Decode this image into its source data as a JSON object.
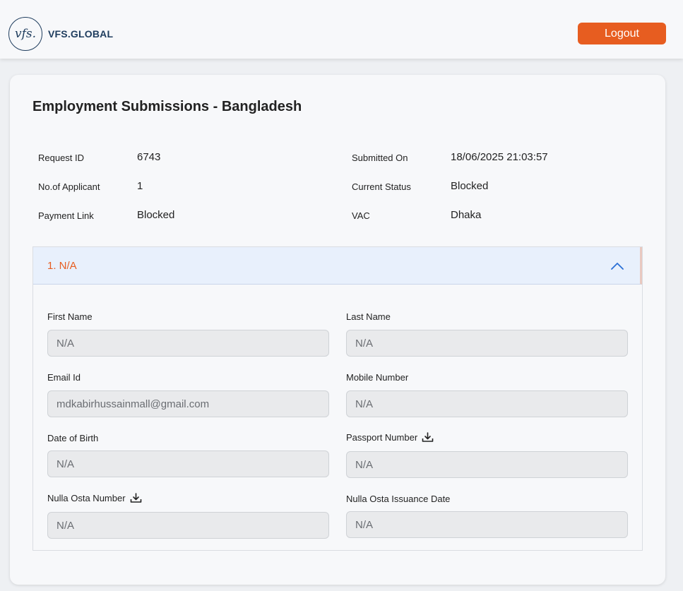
{
  "header": {
    "logo_mark": "vfs.",
    "logo_text": "VFS.GLOBAL",
    "logout_label": "Logout",
    "accent_color": "#e75d20"
  },
  "page": {
    "title": "Employment Submissions - Bangladesh"
  },
  "info": {
    "request_id_label": "Request ID",
    "request_id_value": "6743",
    "applicants_label": "No.of Applicant",
    "applicants_value": "1",
    "payment_link_label": "Payment Link",
    "payment_link_value": "Blocked",
    "submitted_on_label": "Submitted On",
    "submitted_on_value": "18/06/2025 21:03:57",
    "status_label": "Current Status",
    "status_value": "Blocked",
    "vac_label": "VAC",
    "vac_value": "Dhaka"
  },
  "applicant": {
    "title": "1. N/A",
    "chevron_icon": "chevron-up-icon",
    "fields": {
      "first_name_label": "First Name",
      "first_name_value": "N/A",
      "last_name_label": "Last Name",
      "last_name_value": "N/A",
      "email_label": "Email Id",
      "email_value": "mdkabirhussainmall@gmail.com",
      "mobile_label": "Mobile Number",
      "mobile_value": "N/A",
      "dob_label": "Date of Birth",
      "dob_value": "N/A",
      "passport_label": "Passport Number",
      "passport_value": "N/A",
      "nulla_osta_label": "Nulla Osta Number",
      "nulla_osta_value": "N/A",
      "nulla_osta_date_label": "Nulla Osta Issuance Date",
      "nulla_osta_date_value": "N/A"
    }
  }
}
